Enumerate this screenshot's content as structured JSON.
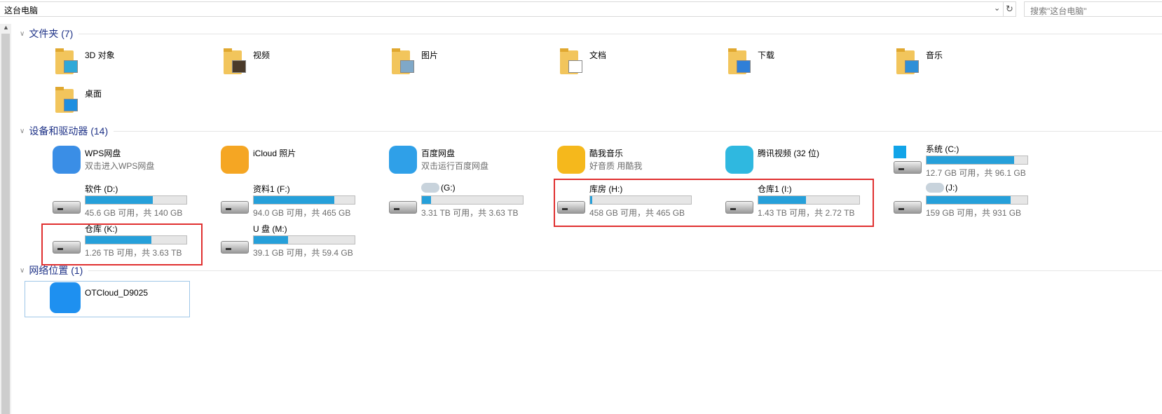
{
  "address": {
    "path": "这台电脑",
    "search_placeholder": "搜索\"这台电脑\""
  },
  "sections": {
    "folders": "文件夹 (7)",
    "devices": "设备和驱动器 (14)",
    "network": "网络位置 (1)"
  },
  "folders": [
    {
      "name": "3D 对象",
      "icon": "3d-objects-icon",
      "color": "#2fa8d8"
    },
    {
      "name": "视频",
      "icon": "videos-icon",
      "color": "#4a3a2a"
    },
    {
      "name": "图片",
      "icon": "pictures-icon",
      "color": "#7fa8c8"
    },
    {
      "name": "文档",
      "icon": "documents-icon",
      "color": "#ffffff"
    },
    {
      "name": "下载",
      "icon": "downloads-icon",
      "color": "#2f7fd8"
    },
    {
      "name": "音乐",
      "icon": "music-icon",
      "color": "#2f8fd8"
    },
    {
      "name": "桌面",
      "icon": "desktop-icon",
      "color": "#1e8fe0"
    }
  ],
  "apps": [
    {
      "name": "WPS网盘",
      "sub": "双击进入WPS网盘",
      "icon": "wps-cloud-icon",
      "color": "#3a8ee6"
    },
    {
      "name": "iCloud 照片",
      "sub": "",
      "icon": "icloud-photos-icon",
      "color": "#f5a623"
    },
    {
      "name": "百度网盘",
      "sub": "双击运行百度网盘",
      "icon": "baidu-netdisk-icon",
      "color": "#2fa0e8"
    },
    {
      "name": "酷我音乐",
      "sub": "好音质 用酷我",
      "icon": "kuwo-music-icon",
      "color": "#f5b81c"
    },
    {
      "name": "腾讯视频 (32 位)",
      "sub": "",
      "icon": "tencent-video-icon",
      "color": "#2fb8e0"
    }
  ],
  "drives": [
    {
      "name": "系统 (C:)",
      "sub": "12.7 GB 可用，共 96.1 GB",
      "used_pct": 87,
      "windows": true
    },
    {
      "name": "软件 (D:)",
      "sub": "45.6 GB 可用，共 140 GB",
      "used_pct": 67
    },
    {
      "name": "资料1 (F:)",
      "sub": "94.0 GB 可用，共 465 GB",
      "used_pct": 80
    },
    {
      "name": "(G:)",
      "sub": "3.31 TB 可用，共 3.63 TB",
      "used_pct": 9,
      "blurred": true
    },
    {
      "name": "库房 (H:)",
      "sub": "458 GB 可用，共 465 GB",
      "used_pct": 2
    },
    {
      "name": "仓库1 (I:)",
      "sub": "1.43 TB 可用，共 2.72 TB",
      "used_pct": 47
    },
    {
      "name": "(J:)",
      "sub": "159 GB 可用，共 931 GB",
      "used_pct": 83,
      "blurred": true
    },
    {
      "name": "仓库 (K:)",
      "sub": "1.26 TB 可用，共 3.63 TB",
      "used_pct": 65
    },
    {
      "name": "U 盘 (M:)",
      "sub": "39.1 GB 可用，共 59.4 GB",
      "used_pct": 34
    }
  ],
  "network": [
    {
      "name": "OTCloud_D9025",
      "icon": "otcloud-icon",
      "color": "#1e90f0"
    }
  ]
}
